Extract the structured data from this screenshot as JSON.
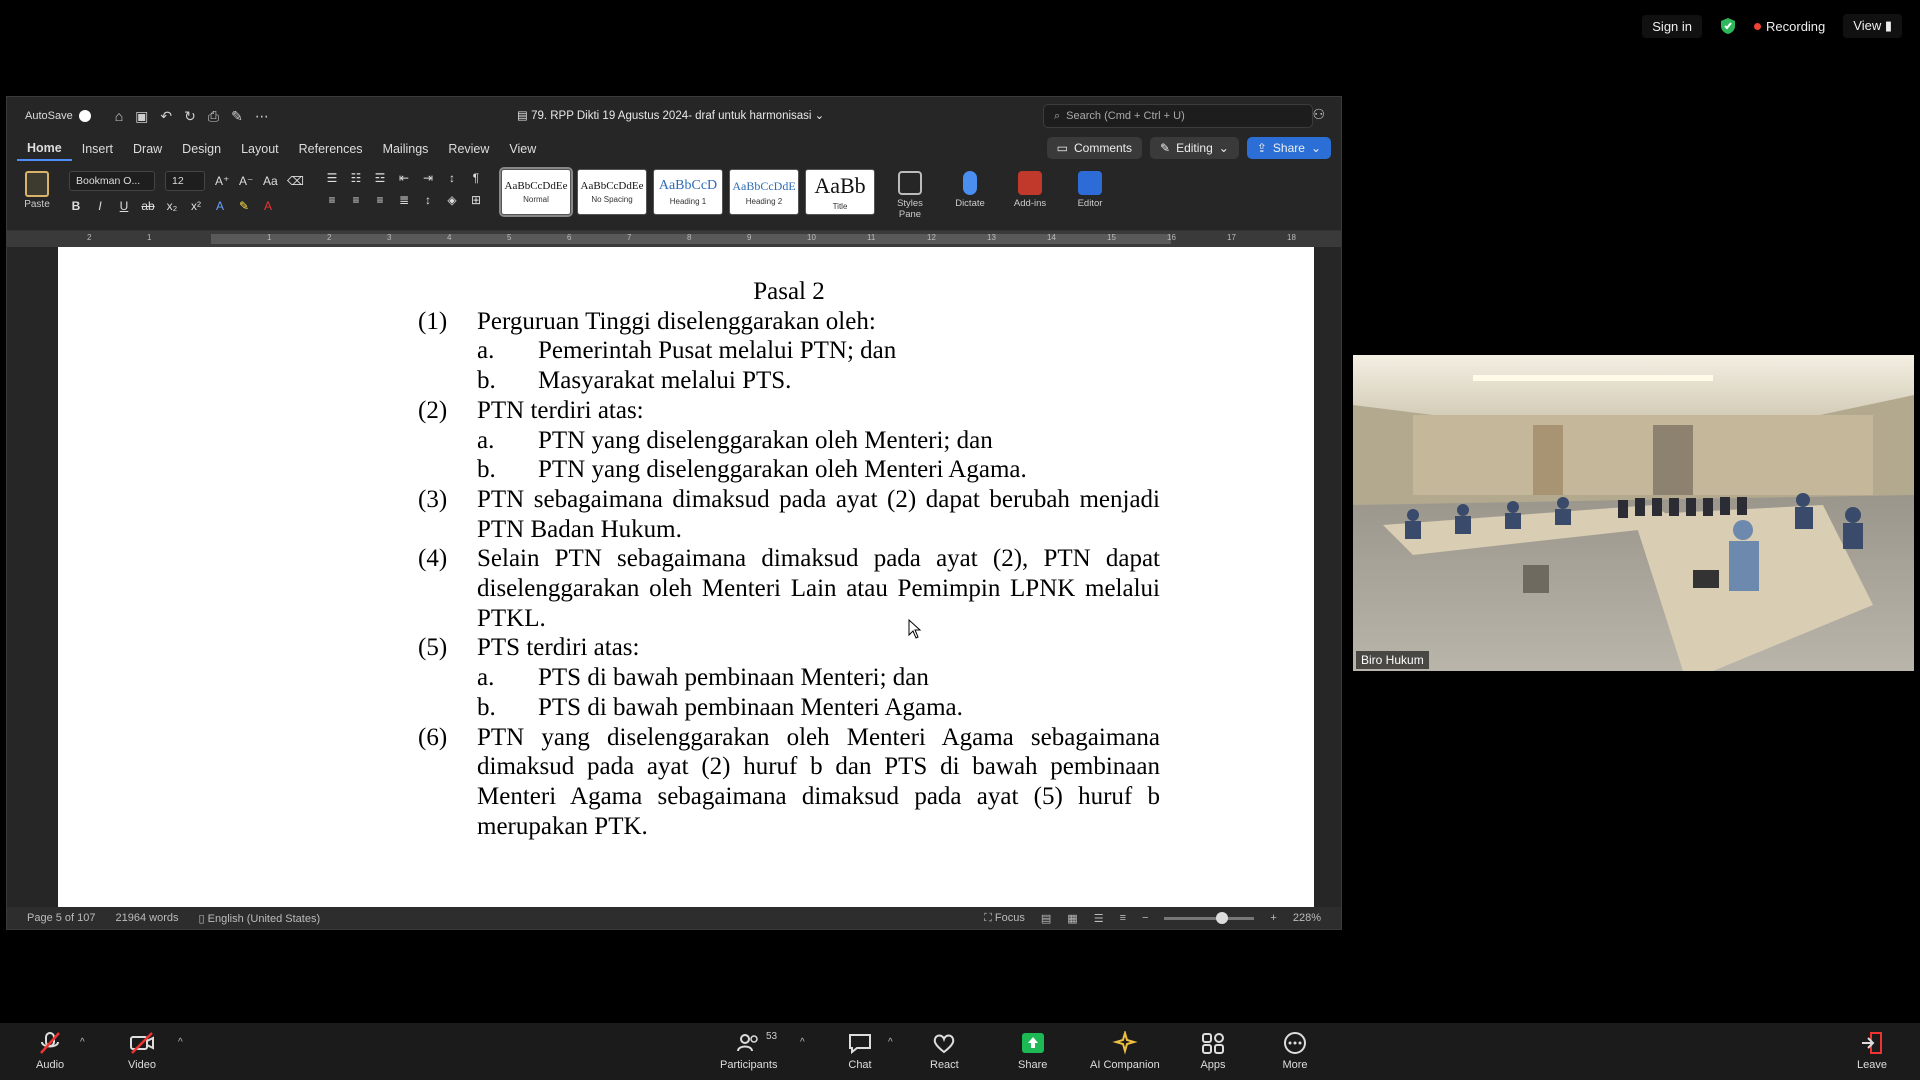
{
  "zoom_top": {
    "sign_in": "Sign in",
    "recording": "Recording",
    "view": "View"
  },
  "word": {
    "autosave_label": "AutoSave",
    "doc_title": "79. RPP Dikti 19 Agustus 2024- draf untuk harmonisasi",
    "search_placeholder": "Search (Cmd + Ctrl + U)",
    "tabs": [
      "Home",
      "Insert",
      "Draw",
      "Design",
      "Layout",
      "References",
      "Mailings",
      "Review",
      "View"
    ],
    "comments_label": "Comments",
    "editing_label": "Editing",
    "share_label": "Share",
    "paste_label": "Paste",
    "font_name": "Bookman O...",
    "font_size": "12",
    "styles": [
      {
        "sample": "AaBbCcDdEe",
        "name": "Normal"
      },
      {
        "sample": "AaBbCcDdEe",
        "name": "No Spacing"
      },
      {
        "sample": "AaBbCcD",
        "name": "Heading 1"
      },
      {
        "sample": "AaBbCcDdE",
        "name": "Heading 2"
      },
      {
        "sample": "AaBb",
        "name": "Title"
      }
    ],
    "styles_pane_label": "Styles Pane",
    "dictate_label": "Dictate",
    "addins_label": "Add-ins",
    "editor_label": "Editor",
    "ruler_numbers": [
      "2",
      "1",
      "1",
      "2",
      "3",
      "4",
      "5",
      "6",
      "7",
      "8",
      "9",
      "10",
      "11",
      "12",
      "13",
      "14",
      "15",
      "16",
      "17",
      "18"
    ],
    "status": {
      "page": "Page 5 of 107",
      "words": "21964 words",
      "language": "English (United States)",
      "focus": "Focus",
      "zoom": "228%"
    }
  },
  "document": {
    "heading": "Pasal 2",
    "paragraphs": [
      {
        "num": "(1)",
        "text": "Perguruan Tinggi diselenggarakan oleh:",
        "items": [
          {
            "letter": "a.",
            "text": "Pemerintah Pusat melalui PTN; dan"
          },
          {
            "letter": "b.",
            "text": "Masyarakat melalui PTS."
          }
        ]
      },
      {
        "num": "(2)",
        "text": "PTN terdiri atas:",
        "items": [
          {
            "letter": "a.",
            "text": "PTN yang diselenggarakan oleh Menteri; dan"
          },
          {
            "letter": "b.",
            "text": "PTN yang diselenggarakan oleh Menteri Agama."
          }
        ]
      },
      {
        "num": "(3)",
        "text": "PTN sebagaimana dimaksud pada ayat (2) dapat berubah menjadi PTN Badan Hukum.",
        "items": []
      },
      {
        "num": "(4)",
        "text": "Selain PTN sebagaimana dimaksud pada ayat (2), PTN dapat diselenggarakan oleh Menteri Lain atau Pemimpin LPNK melalui PTKL.",
        "items": []
      },
      {
        "num": "(5)",
        "text": "PTS terdiri atas:",
        "items": [
          {
            "letter": "a.",
            "text": "PTS di bawah pembinaan Menteri; dan"
          },
          {
            "letter": "b.",
            "text": "PTS di bawah pembinaan Menteri Agama."
          }
        ]
      },
      {
        "num": "(6)",
        "text": "PTN yang diselenggarakan oleh Menteri Agama sebagaimana dimaksud pada ayat (2) huruf b dan PTS di bawah pembinaan Menteri Agama sebagaimana dimaksud pada ayat (5) huruf b merupakan PTK.",
        "items": []
      }
    ]
  },
  "video": {
    "participant_name": "Biro Hukum"
  },
  "toolbar": {
    "audio": "Audio",
    "video": "Video",
    "participants": "Participants",
    "participants_count": "53",
    "chat": "Chat",
    "react": "React",
    "share": "Share",
    "ai_companion": "AI Companion",
    "apps": "Apps",
    "more": "More",
    "leave": "Leave"
  }
}
